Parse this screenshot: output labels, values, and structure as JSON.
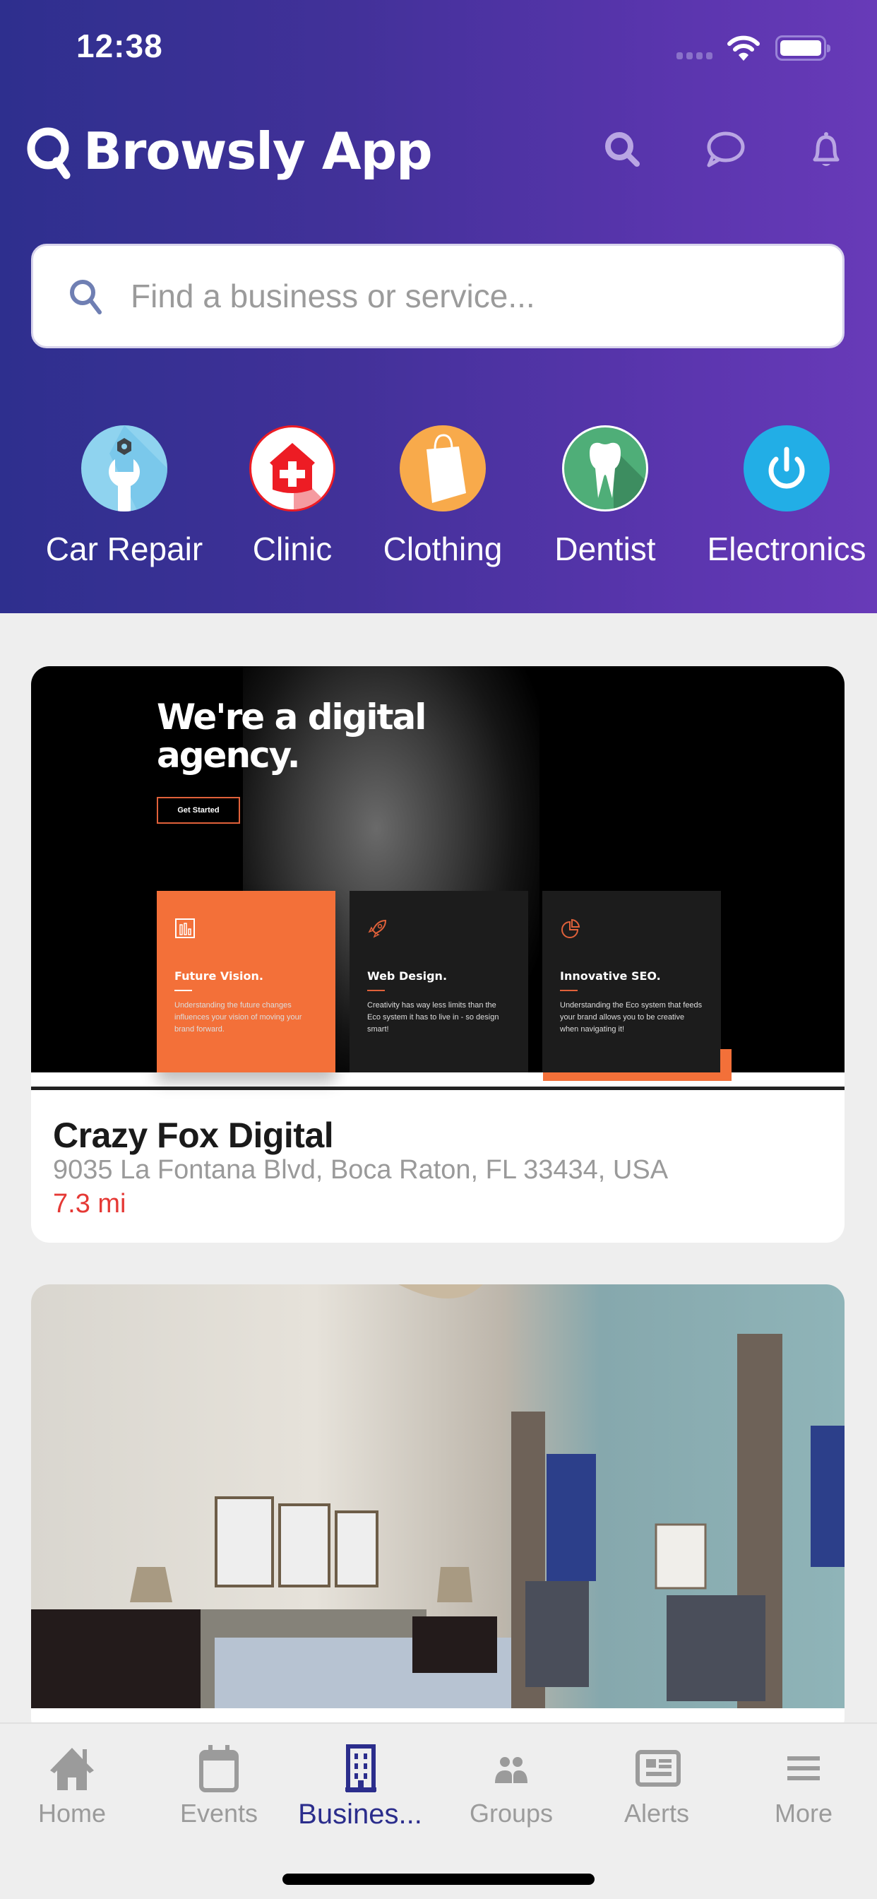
{
  "status_bar": {
    "time": "12:38"
  },
  "header": {
    "app_title": "Browsly App",
    "gradient_start": "#2e2f8e",
    "gradient_end": "#683ab8",
    "icon_color": "#b9a6e3",
    "icons": [
      "search-icon",
      "chat-bubble-icon",
      "bell-icon"
    ]
  },
  "search": {
    "placeholder": "Find a business or service...",
    "value": ""
  },
  "categories": [
    {
      "label": "Car Repair",
      "icon": "wrench-icon",
      "color": "#8fd3ef"
    },
    {
      "label": "Clinic",
      "icon": "medical-house-icon",
      "color": "#ed1c24"
    },
    {
      "label": "Clothing",
      "icon": "shopping-bag-icon",
      "color": "#f8aa4b"
    },
    {
      "label": "Dentist",
      "icon": "tooth-icon",
      "color": "#4fae78"
    },
    {
      "label": "Electronics",
      "icon": "power-icon",
      "color": "#22aee6"
    }
  ],
  "listings": [
    {
      "name": "Crazy Fox Digital",
      "address": "9035 La Fontana Blvd, Boca Raton, FL 33434, USA",
      "distance": "7.3 mi",
      "image": {
        "headline_1": "We're a digital",
        "headline_2": "agency.",
        "button": "Get Started",
        "boxes": [
          {
            "title": "Future Vision.",
            "text": "Understanding the future changes influences your vision of moving your brand forward."
          },
          {
            "title": "Web Design.",
            "text": "Creativity has way less limits than the Eco system it has to live in - so design smart!"
          },
          {
            "title": "Innovative SEO.",
            "text": "Understanding the Eco system that feeds your brand allows you to be creative when navigating it!"
          }
        ]
      }
    },
    {
      "image_description": "bedroom interior"
    }
  ],
  "tabs": [
    {
      "label": "Home",
      "icon": "home-icon",
      "active": false
    },
    {
      "label": "Events",
      "icon": "calendar-icon",
      "active": false
    },
    {
      "label": "Busines...",
      "icon": "building-icon",
      "active": true
    },
    {
      "label": "Groups",
      "icon": "groups-icon",
      "active": false
    },
    {
      "label": "Alerts",
      "icon": "newspaper-icon",
      "active": false
    },
    {
      "label": "More",
      "icon": "menu-icon",
      "active": false
    }
  ],
  "colors": {
    "accent": "#2b2d8c",
    "distance": "#e53935",
    "inactive_tab": "#9b9b9b",
    "background": "#eeeeee"
  }
}
